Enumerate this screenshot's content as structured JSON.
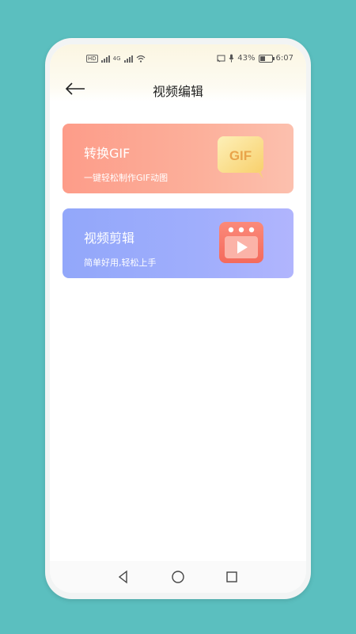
{
  "status_bar": {
    "left_chip": "HD",
    "network_label": "4G",
    "battery_percent": "43%",
    "time": "6:07"
  },
  "header": {
    "title": "视频编辑"
  },
  "cards": [
    {
      "title": "转换GIF",
      "subtitle": "一键轻松制作GIF动图",
      "icon_text": "GIF",
      "icon": "gif-chat-bubble-icon"
    },
    {
      "title": "视频剪辑",
      "subtitle": "简单好用,轻松上手",
      "icon": "video-player-icon"
    }
  ],
  "nav": {
    "icons": [
      "back-triangle-icon",
      "home-circle-icon",
      "recents-square-icon"
    ]
  },
  "colors": {
    "background": "#5bbfbf",
    "card1_gradient": [
      "#fd9c89",
      "#fcc0ae"
    ],
    "card2_gradient": [
      "#92a7fa",
      "#b1b5fd"
    ]
  }
}
